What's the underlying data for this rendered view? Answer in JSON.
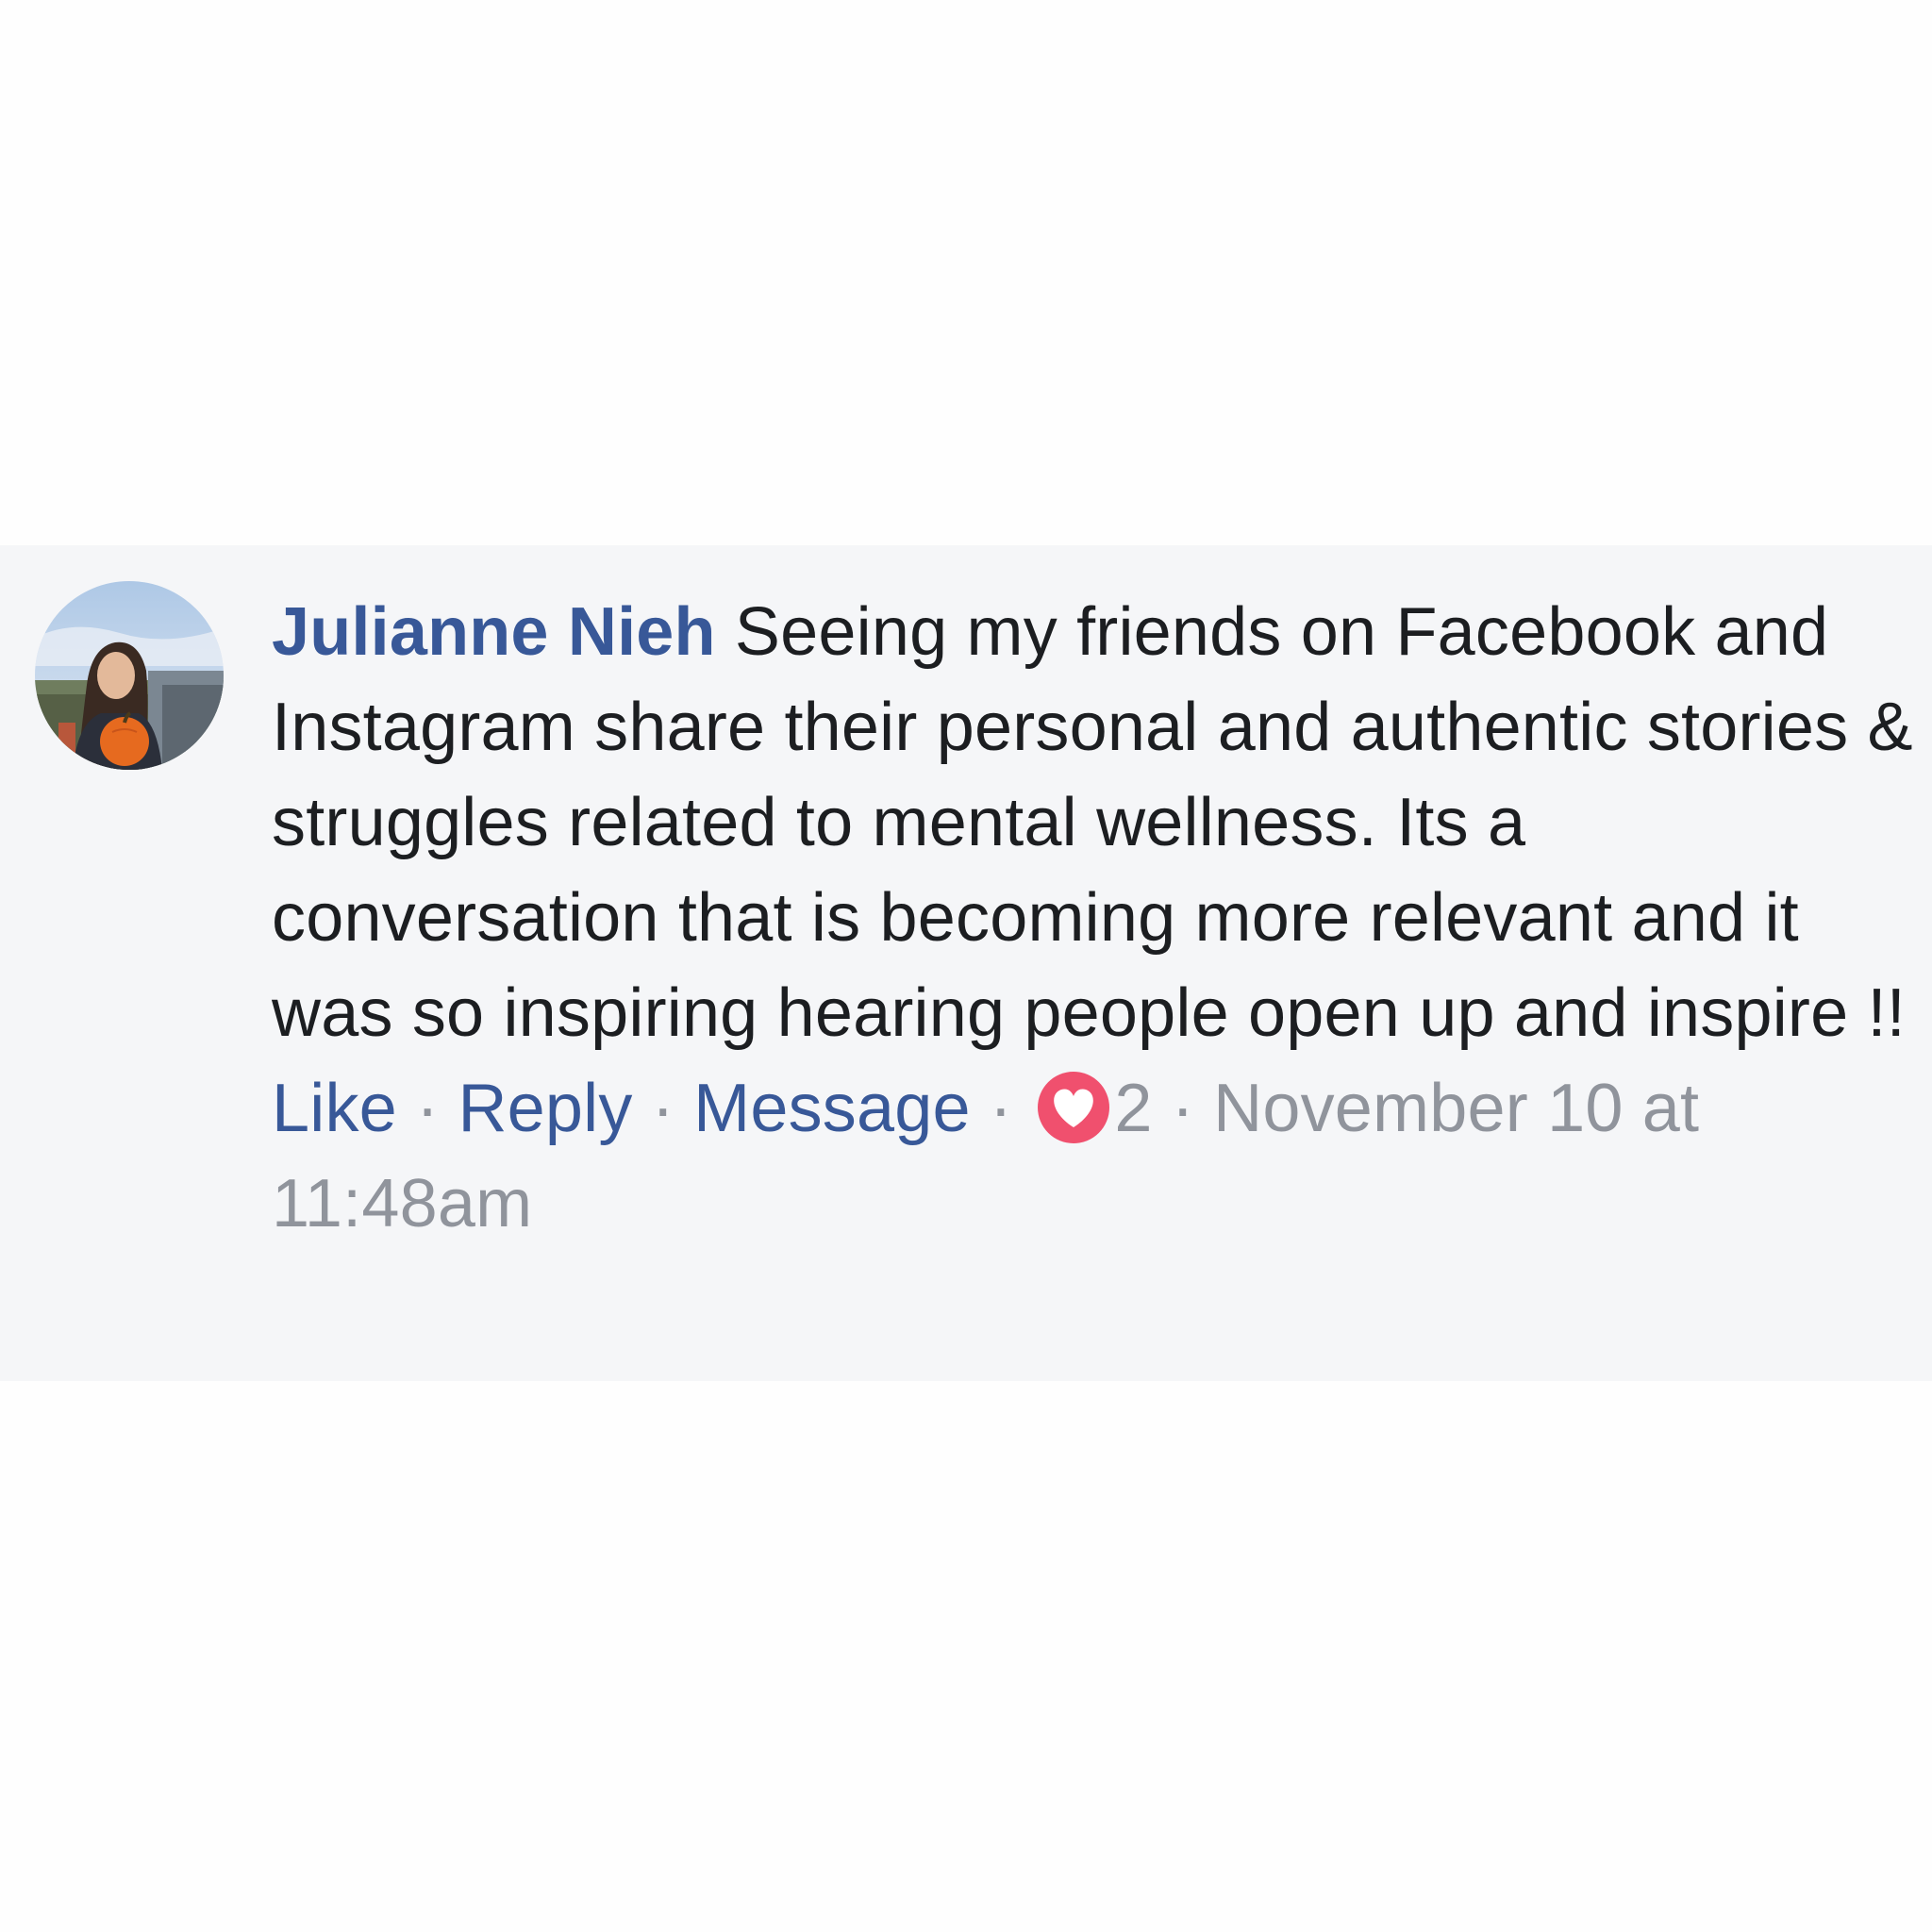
{
  "comment": {
    "author": "Julianne Nieh",
    "text": " Seeing my friends on Facebook and Instagram share their personal and authentic stories & struggles related to mental wellness. Its a conversation that is becoming more relevant and it was so inspiring hearing people open up and inspire !!",
    "actions": {
      "like_label": "Like",
      "reply_label": "Reply",
      "message_label": "Message",
      "separator": " · "
    },
    "reaction": {
      "icon": "heart-icon",
      "count": "2"
    },
    "timestamp": "November 10 at 11:48am"
  },
  "colors": {
    "link_blue": "#385898",
    "text_dark": "#1c1e21",
    "meta_gray": "#90949c",
    "heart_red": "#f0506e",
    "card_background": "#f5f6f8"
  }
}
